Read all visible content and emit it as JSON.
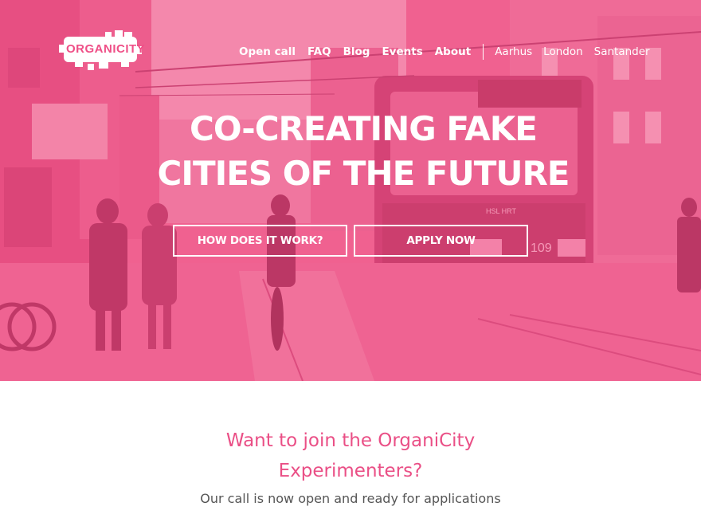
{
  "brand": {
    "logo_text": "ORGANICITY",
    "accent": "#ef5b8e"
  },
  "nav": {
    "items": [
      {
        "label": "Open call"
      },
      {
        "label": "FAQ"
      },
      {
        "label": "Blog"
      },
      {
        "label": "Events"
      },
      {
        "label": "About"
      }
    ],
    "cities": [
      {
        "label": "Aarhus"
      },
      {
        "label": "London"
      },
      {
        "label": "Santander"
      }
    ]
  },
  "hero": {
    "headline_line1": "CO-CREATING FAKE",
    "headline_line2": "CITIES OF THE FUTURE",
    "how_button": "HOW DOES IT WORK?",
    "apply_button": "APPLY NOW",
    "tram_number": "109",
    "tram_sign": "HSL HRT"
  },
  "cta": {
    "title_line1": "Want to join the OrganiCity",
    "title_line2": "Experimenters?",
    "subtitle": "Our call is now open and ready for applications"
  }
}
